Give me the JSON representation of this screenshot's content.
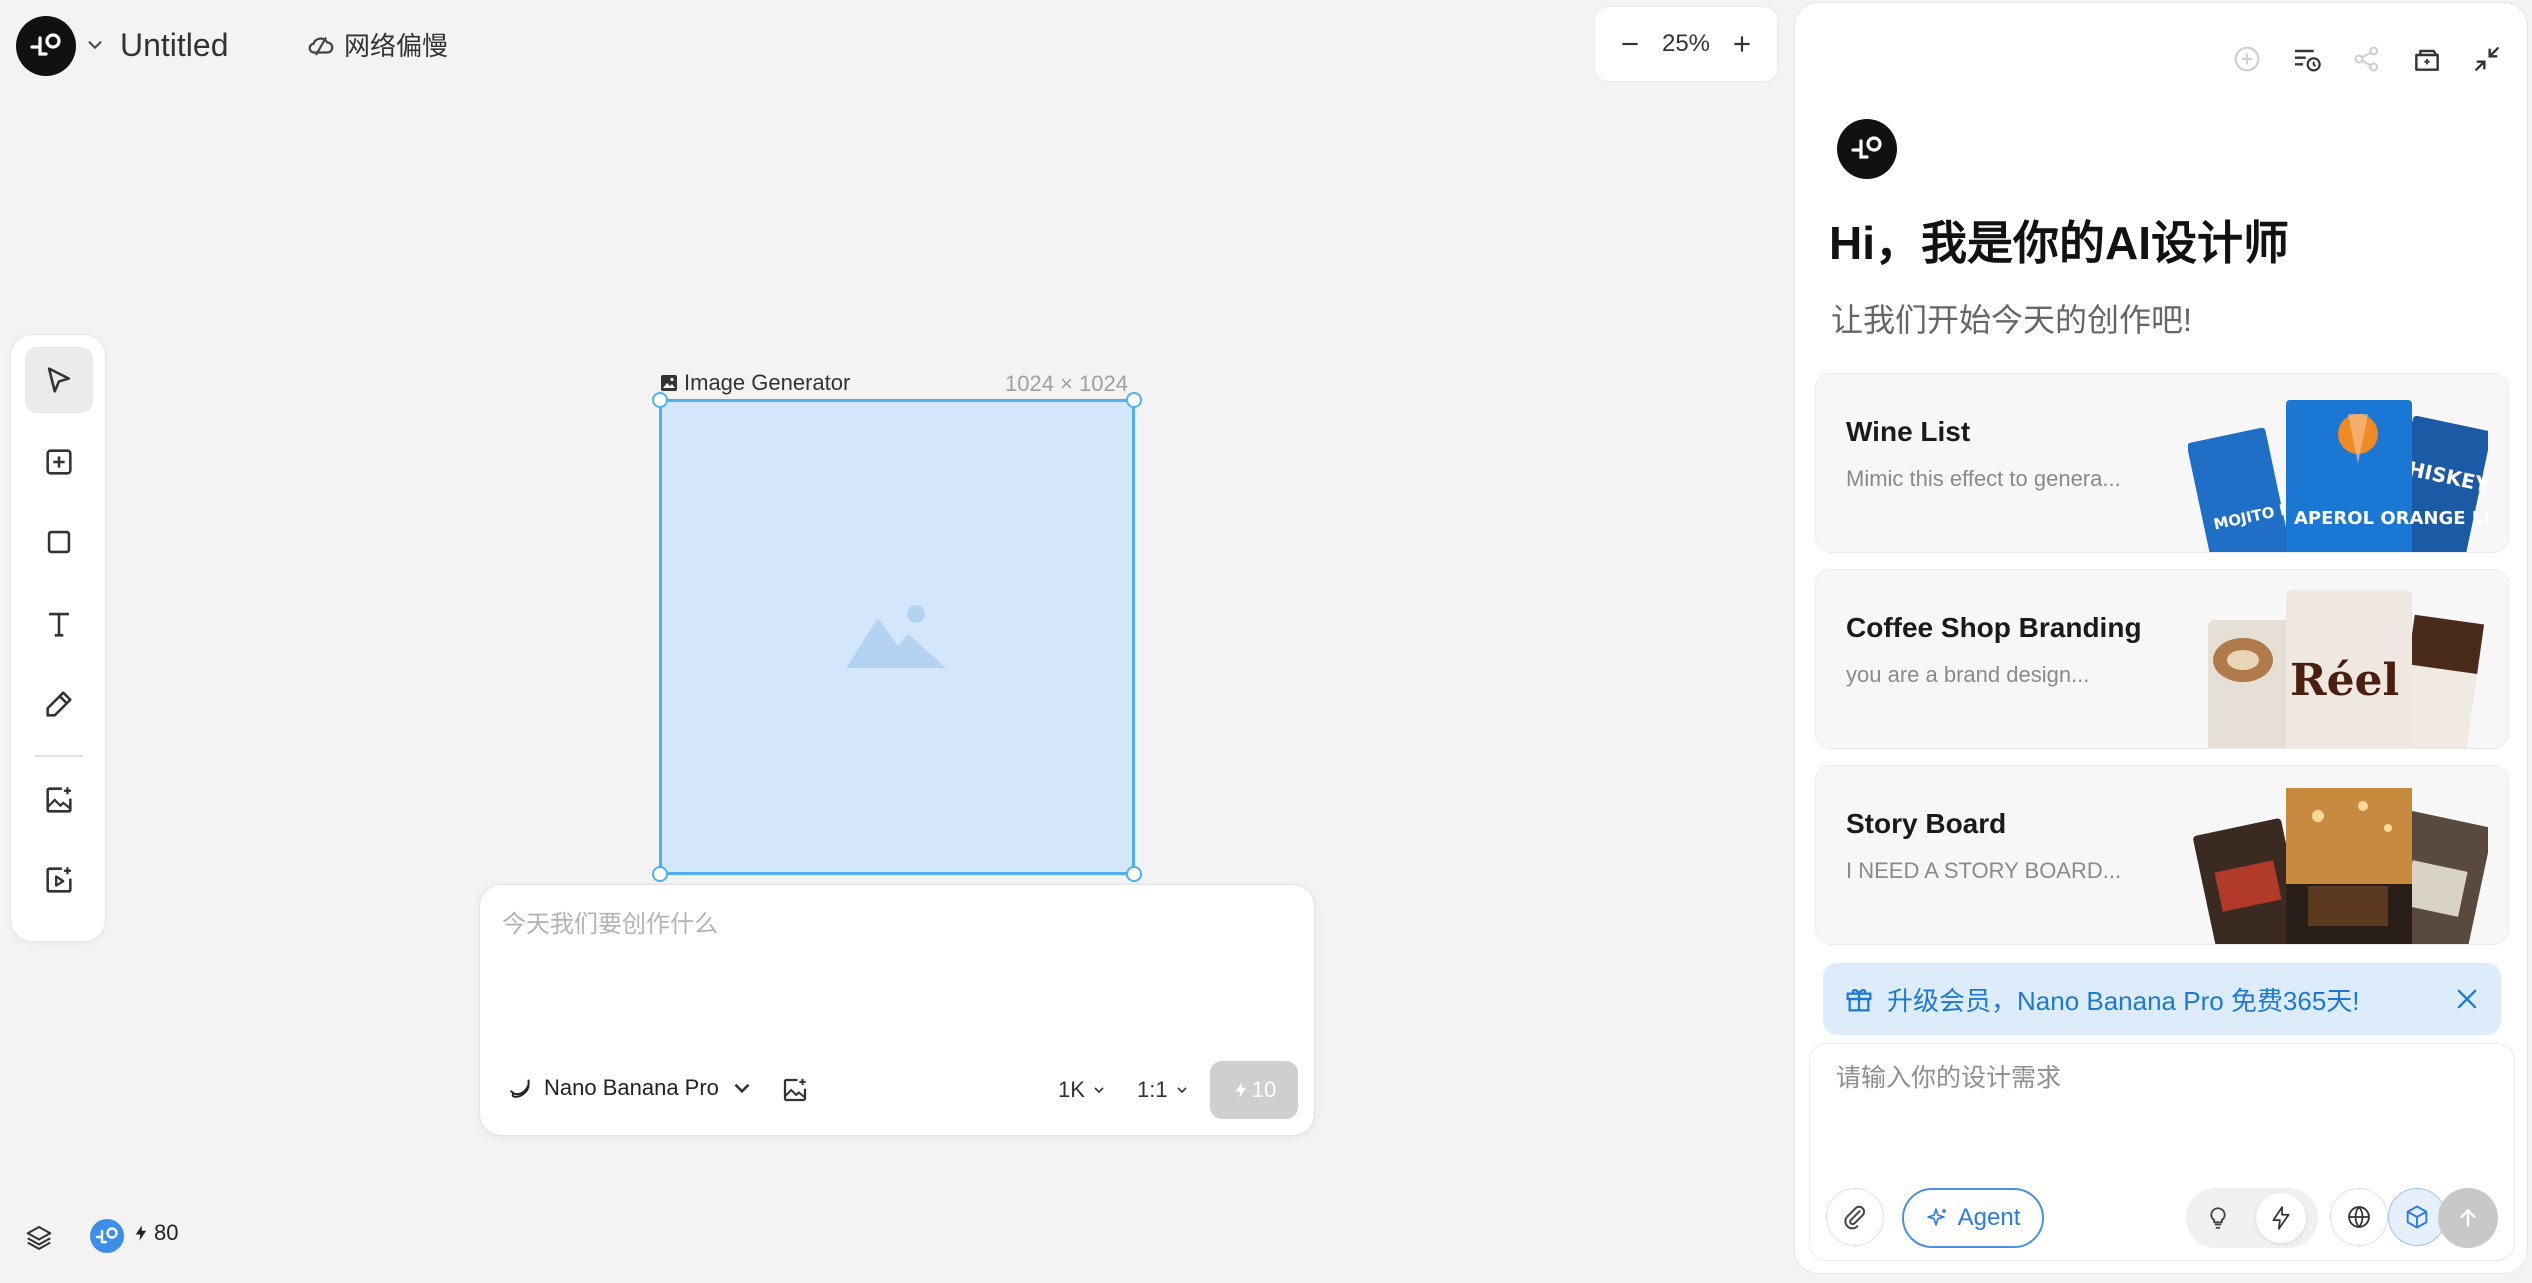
{
  "app": {
    "doc_title": "Untitled",
    "network_status": "网络偏慢",
    "zoom": "25%"
  },
  "frame": {
    "label": "Image Generator",
    "size": "1024 × 1024"
  },
  "prompt": {
    "placeholder": "今天我们要创作什么",
    "model": "Nano Banana Pro",
    "resolution": "1K",
    "ratio": "1:1",
    "cost": "10"
  },
  "footer": {
    "credits": "80"
  },
  "panel": {
    "greeting": "Hi，我是你的AI设计师",
    "subgreeting": "让我们开始今天的创作吧!",
    "cards": [
      {
        "title": "Wine List",
        "desc": "Mimic this effect to genera..."
      },
      {
        "title": "Coffee Shop Branding",
        "desc": "you are a brand design..."
      },
      {
        "title": "Story Board",
        "desc": "I NEED A STORY BOARD..."
      }
    ],
    "card_art_text": {
      "wine_left": "MOJITO MINT FRESH",
      "wine_center": "APEROL ORANGE LIGHT",
      "wine_right": "HISKEY",
      "coffee": "Réel"
    },
    "promo": "升级会员，Nano Banana Pro 免费365天!",
    "chat_placeholder": "请输入你的设计需求",
    "agent_label": "Agent"
  },
  "colors": {
    "accent_blue": "#2c7be5",
    "frame_border": "#4eb0ec",
    "frame_fill": "#d3e6fb",
    "promo_bg": "#ddecfb"
  }
}
